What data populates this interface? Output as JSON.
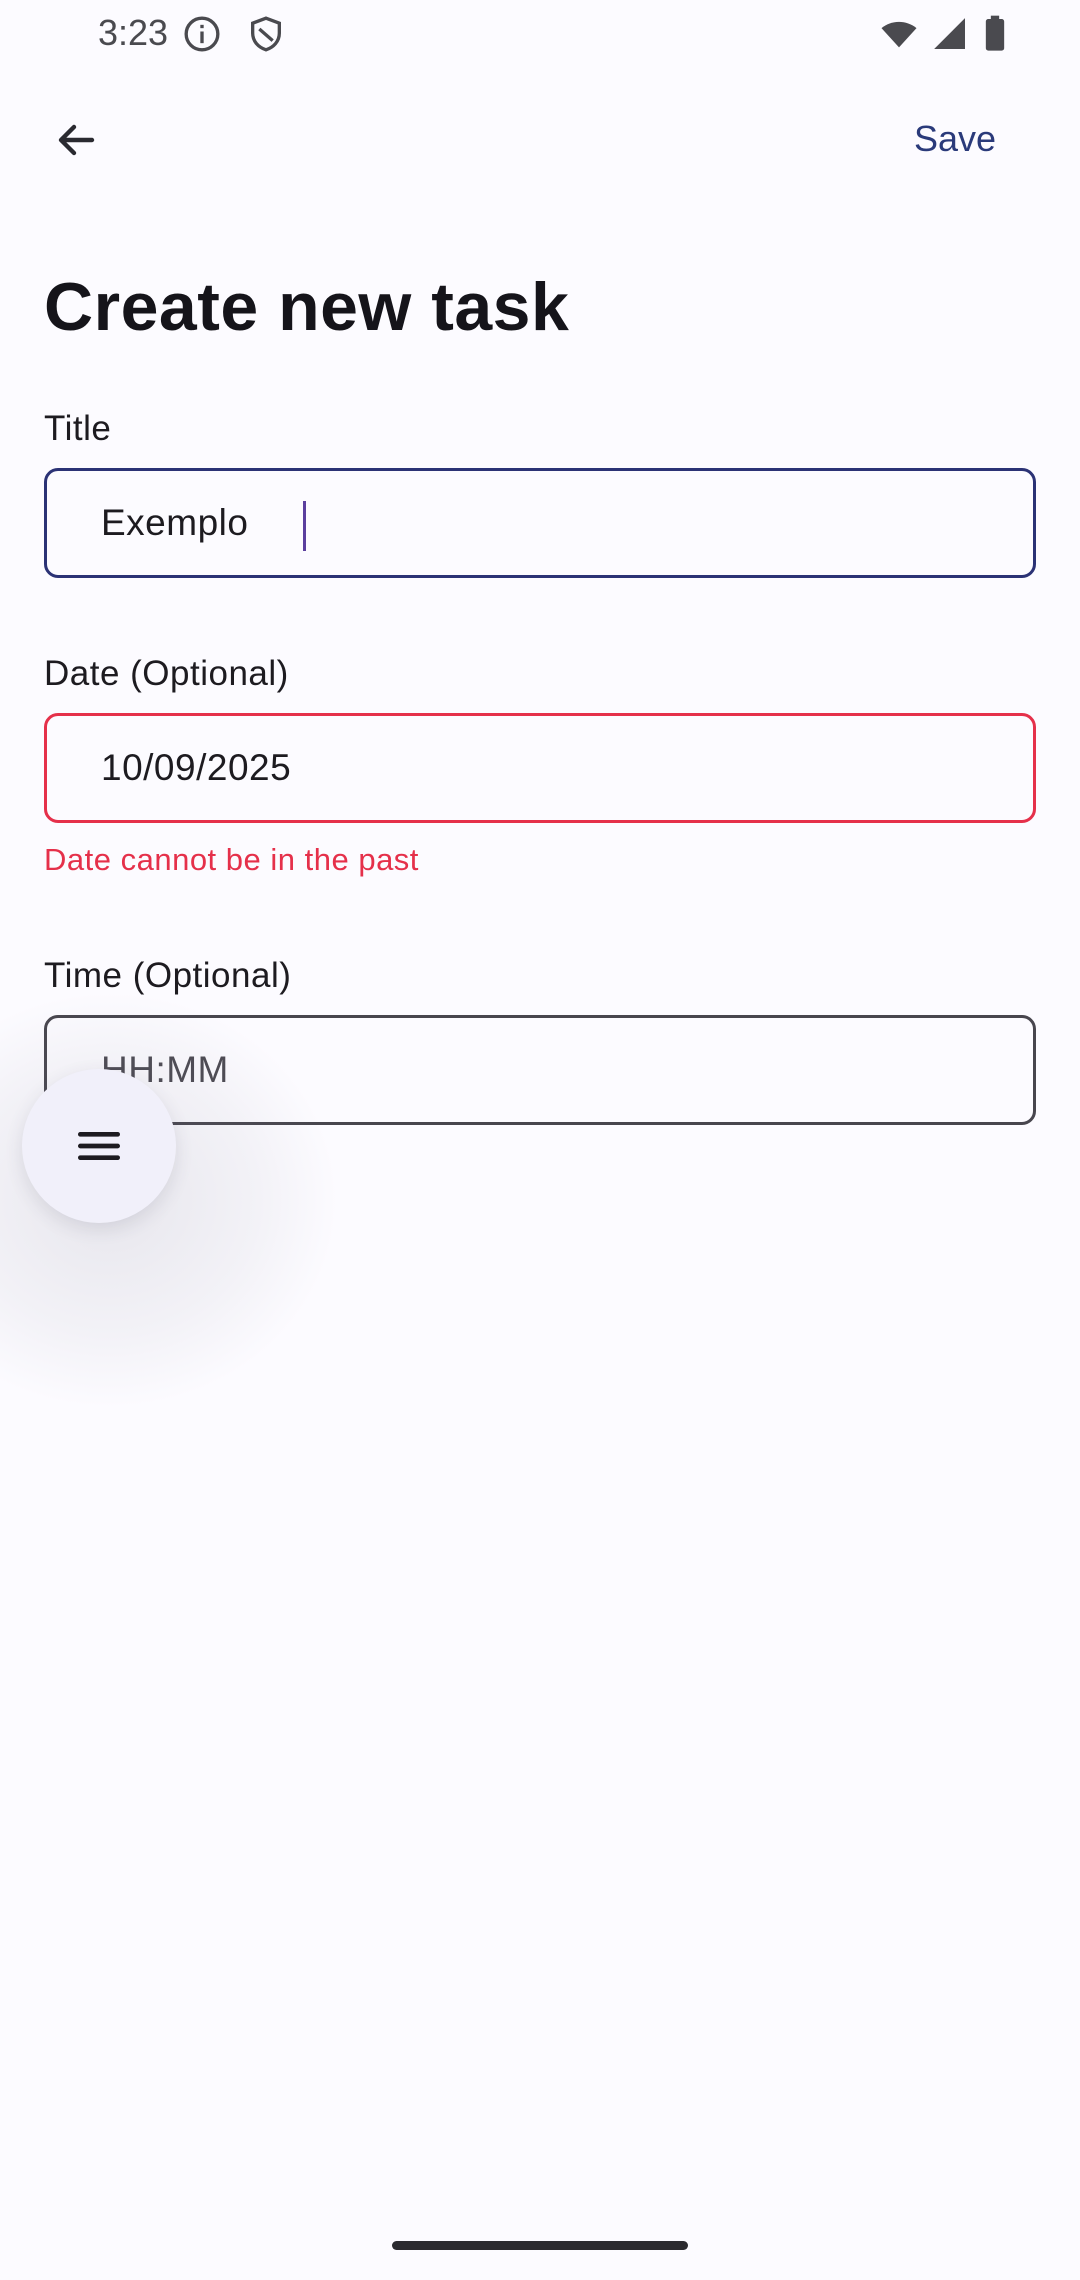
{
  "status_bar": {
    "time": "3:23",
    "icons": [
      "info-icon",
      "shield-icon",
      "wifi-icon",
      "signal-icon",
      "battery-icon"
    ]
  },
  "app_bar": {
    "back_icon": "arrow-back-icon",
    "save_label": "Save"
  },
  "page_title": "Create new task",
  "form": {
    "title": {
      "label": "Title",
      "value": "Exemplo"
    },
    "date": {
      "label": "Date (Optional)",
      "value": "10/09/2025",
      "error": "Date cannot be in the past"
    },
    "time": {
      "label": "Time (Optional)",
      "placeholder": "HH:MM"
    }
  },
  "fab": {
    "icon": "menu-icon"
  },
  "colors": {
    "accent": "#2b3275",
    "error": "#e5304a",
    "save_text": "#2a3a7a",
    "background": "#fcfbff"
  }
}
